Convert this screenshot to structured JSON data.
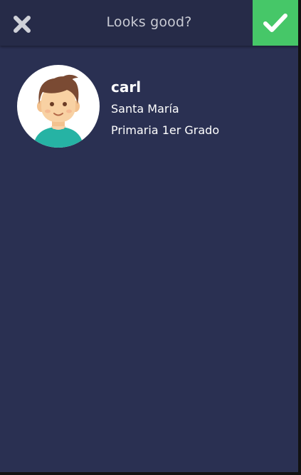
{
  "header": {
    "title": "Looks good?",
    "close_icon": "close-icon",
    "confirm_icon": "check-icon",
    "confirm_color": "#46c768"
  },
  "profile": {
    "name": "carl",
    "school": "Santa María",
    "grade": "Primaria 1er Grado",
    "avatar_icon": "boy-avatar-icon"
  },
  "colors": {
    "background": "#2a3052",
    "header": "#262b48"
  }
}
